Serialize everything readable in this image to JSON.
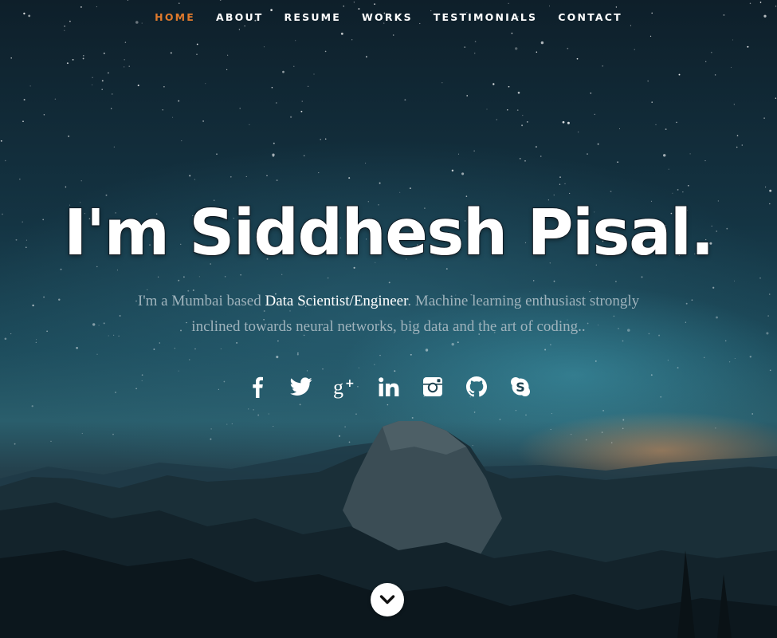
{
  "nav": {
    "items": [
      {
        "label": "HOME",
        "active": true
      },
      {
        "label": "ABOUT",
        "active": false
      },
      {
        "label": "RESUME",
        "active": false
      },
      {
        "label": "WORKS",
        "active": false
      },
      {
        "label": "TESTIMONIALS",
        "active": false
      },
      {
        "label": "CONTACT",
        "active": false
      }
    ]
  },
  "hero": {
    "headline": "I'm Siddhesh Pisal.",
    "intro_before": "I'm a Mumbai based ",
    "intro_role": "Data Scientist/Engineer",
    "intro_after": ". Machine learning enthusiast strongly inclined towards neural networks, big data and the art of coding.."
  },
  "social": [
    {
      "icon": "facebook-icon"
    },
    {
      "icon": "twitter-icon"
    },
    {
      "icon": "google-plus-icon"
    },
    {
      "icon": "linkedin-icon"
    },
    {
      "icon": "instagram-icon"
    },
    {
      "icon": "github-icon"
    },
    {
      "icon": "skype-icon"
    }
  ],
  "scroll_down": {
    "icon": "chevron-down-icon"
  },
  "colors": {
    "nav_active": "#e07a2c",
    "nav_text": "#ffffff",
    "headline": "#ffffff",
    "intro_text": "#9fb3bc",
    "intro_highlight": "#ffffff"
  }
}
